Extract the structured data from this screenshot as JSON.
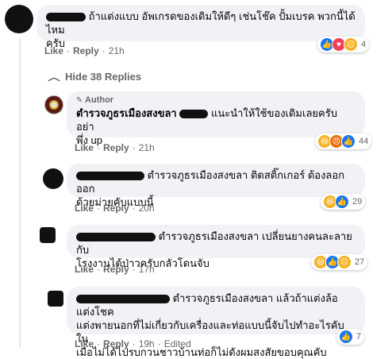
{
  "comments": [
    {
      "text_line1": "ถ้าแต่งแบบ อัพเกรดของเดิมให้ดีๆ เช่นโช๊ค ปั้มเบรค พวกนี้ได้ไหม",
      "text_line2": "ครับ",
      "like": "Like",
      "reply": "Reply",
      "time": "21h",
      "reaction_count": "4",
      "reactions": [
        "like-icon",
        "love-icon",
        "sad-icon"
      ]
    }
  ],
  "hide_replies": "Hide 38 Replies",
  "replies": [
    {
      "badge": "Author",
      "name": "ตำรวจภูธรเมืองสงขลา",
      "text_line1": "แนะนำให้ใช้ของเดิมเลยครับ อย่า",
      "text_line2": "พึ่ง up",
      "like": "Like",
      "reply": "Reply",
      "time": "21h",
      "reaction_count": "44",
      "reactions": [
        "haha-icon",
        "angry-icon",
        "like-icon"
      ]
    },
    {
      "mention": "ตำรวจภูธรเมืองสงขลา",
      "text_line1": "ติดสติ๊กเกอร์ ต้องลอกออก",
      "text_line2": "ด้วยม่ายคับแบบนี้",
      "like": "Like",
      "reply": "Reply",
      "time": "20h",
      "reaction_count": "29",
      "reactions": [
        "haha-icon",
        "like-icon"
      ]
    },
    {
      "mention": "ตำรวจภูธรเมืองสงขลา",
      "text_line1": "เปลี่ยนยางคนละลายกับ",
      "text_line2": "โรงงานได้ป่าวครับกลัวโดนจับ",
      "like": "Like",
      "reply": "Reply",
      "time": "17h",
      "reaction_count": "27",
      "reactions": [
        "haha-icon",
        "like-icon",
        "sad-icon"
      ]
    },
    {
      "mention": "ตำรวจภูธรเมืองสงขลา",
      "text_line1": "แล้วถ้าแต่งล้อแต่งโชค",
      "text_line2": "แต่งพายนอกที่ไม่เกี่ยวกับเครื่องและท่อแบบนี้จับไปทำอะไรคับใน",
      "text_line3": "เมื่อไม่ได้ไปรบกวนชาวบ้านท่อก็ไม่ดังผมสงสัยขอบคุณคับ",
      "like": "Like",
      "reply": "Reply",
      "time": "19h",
      "edited": "Edited",
      "reaction_count": "7",
      "reactions": [
        "like-icon"
      ]
    }
  ]
}
